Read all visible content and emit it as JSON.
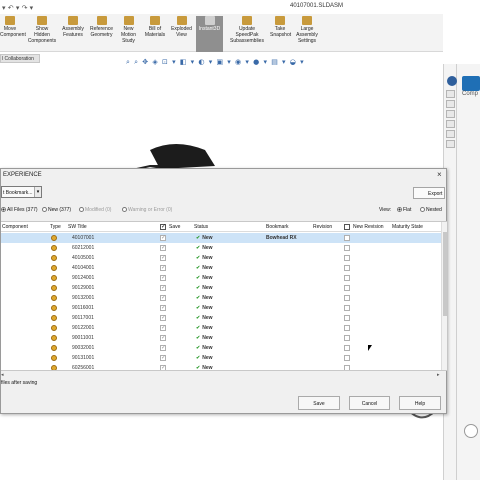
{
  "app": {
    "title": "40107001.SLDASM"
  },
  "ribbon": {
    "buttons": [
      {
        "label": "Move\nComponent",
        "icon": "move-component-icon"
      },
      {
        "label": "Show\nHidden\nComponents",
        "icon": "show-hidden-icon"
      },
      {
        "label": "Assembly\nFeatures",
        "icon": "assembly-features-icon"
      },
      {
        "label": "Reference\nGeometry",
        "icon": "reference-geometry-icon"
      },
      {
        "label": "New\nMotion\nStudy",
        "icon": "motion-study-icon"
      },
      {
        "label": "Bill of\nMaterials",
        "icon": "bom-icon"
      },
      {
        "label": "Exploded\nView",
        "icon": "exploded-view-icon"
      },
      {
        "label": "Instant3D",
        "icon": "instant3d-icon"
      },
      {
        "label": "Update\nSpeedPak\nSubassemblies",
        "icon": "speedpak-icon"
      },
      {
        "label": "Take\nSnapshot",
        "icon": "snapshot-icon"
      },
      {
        "label": "Large\nAssembly\nSettings",
        "icon": "large-assembly-icon"
      }
    ]
  },
  "tabs": {
    "collaboration": "l Collaboration"
  },
  "right_panel": {
    "label": "Comp"
  },
  "dialog": {
    "title": "EXPERIENCE",
    "close": "×",
    "bookmark_button": "t Bookmark...",
    "export_button": "Export",
    "filters": {
      "all": "All Files (377)",
      "new": "New (377)",
      "modified": "Modified (0)",
      "warning": "Warning or Error (0)",
      "view_label": "View:",
      "flat": "Flat",
      "nested": "Nested"
    },
    "columns": [
      "Component",
      "Type",
      "SW Title",
      "Save",
      "Status",
      "Bookmark",
      "Revision",
      "New Revision",
      "Maturity State"
    ],
    "rows": [
      {
        "title": "40107001",
        "status": "New",
        "bookmark": "Bowhead RX"
      },
      {
        "title": "60212001",
        "status": "New",
        "bookmark": ""
      },
      {
        "title": "40105001",
        "status": "New",
        "bookmark": ""
      },
      {
        "title": "40104001",
        "status": "New",
        "bookmark": ""
      },
      {
        "title": "90124001",
        "status": "New",
        "bookmark": ""
      },
      {
        "title": "90129001",
        "status": "New",
        "bookmark": ""
      },
      {
        "title": "90132001",
        "status": "New",
        "bookmark": ""
      },
      {
        "title": "90116001",
        "status": "New",
        "bookmark": ""
      },
      {
        "title": "90117001",
        "status": "New",
        "bookmark": ""
      },
      {
        "title": "90122001",
        "status": "New",
        "bookmark": ""
      },
      {
        "title": "90011001",
        "status": "New",
        "bookmark": ""
      },
      {
        "title": "90032001",
        "status": "New",
        "bookmark": ""
      },
      {
        "title": "90131001",
        "status": "New",
        "bookmark": ""
      },
      {
        "title": "60256001",
        "status": "New",
        "bookmark": ""
      }
    ],
    "option_text": "files after saving",
    "buttons": {
      "save": "Save",
      "cancel": "Cancel",
      "help": "Help"
    }
  },
  "colors": {
    "selection": "#cde3f7",
    "status_check": "#2f9b2f",
    "instant3d_active": "#8f8f8f"
  }
}
